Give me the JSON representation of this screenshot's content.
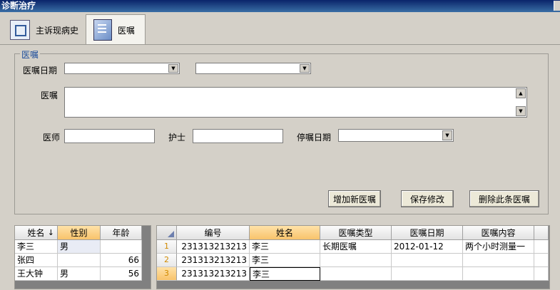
{
  "window": {
    "title": "诊断治疗"
  },
  "tabs": [
    {
      "label": "主诉现病史",
      "icon": "document-icon"
    },
    {
      "label": "医嘱",
      "icon": "order-sheet-icon"
    }
  ],
  "form": {
    "group_title": "医嘱",
    "order_date_label": "医嘱日期",
    "order_label": "医嘱",
    "doctor_label": "医师",
    "nurse_label": "护士",
    "stop_date_label": "停嘱日期",
    "order_date_value": "",
    "order_type_value": "",
    "order_text": "",
    "doctor_value": "",
    "nurse_value": "",
    "stop_date_value": ""
  },
  "buttons": {
    "add": "增加新医嘱",
    "save": "保存修改",
    "delete": "删除此条医嘱"
  },
  "patients": {
    "columns": [
      "姓名",
      "性别",
      "年龄"
    ],
    "sort_indicator": "↓",
    "rows": [
      {
        "name": "李三",
        "sex": "男",
        "age": ""
      },
      {
        "name": "张四",
        "sex": "",
        "age": "66"
      },
      {
        "name": "王大钟",
        "sex": "男",
        "age": "56"
      }
    ]
  },
  "orders": {
    "columns": [
      "编号",
      "姓名",
      "医嘱类型",
      "医嘱日期",
      "医嘱内容"
    ],
    "rows": [
      {
        "num": "1",
        "id": "231313213213",
        "name": "李三",
        "type": "长期医嘱",
        "date": "2012-01-12",
        "content": "两个小时测量一"
      },
      {
        "num": "2",
        "id": "231313213213",
        "name": "李三",
        "type": "",
        "date": "",
        "content": ""
      },
      {
        "num": "3",
        "id": "231313213213",
        "name": "李三",
        "type": "",
        "date": "",
        "content": ""
      }
    ]
  }
}
